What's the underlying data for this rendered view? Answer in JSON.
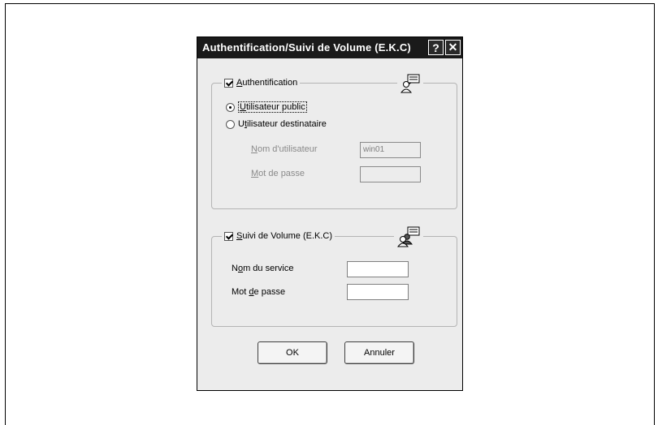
{
  "dialog": {
    "title": "Authentification/Suivi de Volume  (E.K.C)",
    "help_glyph": "?",
    "close_glyph": "✕"
  },
  "auth": {
    "legend_first": "A",
    "legend_rest": "uthentification",
    "checked": true,
    "icon": "user-card-icon",
    "public_first": "U",
    "public_rest": "tilisateur public",
    "dest_pre": "U",
    "dest_u": "t",
    "dest_rest": "ilisateur destinataire",
    "username_first": "N",
    "username_rest": "om d'utilisateur",
    "username_value": "win01",
    "password_first": "M",
    "password_rest": "ot de passe",
    "password_value": ""
  },
  "ekc": {
    "legend_first": "S",
    "legend_rest": "uivi de Volume  (E.K.C)",
    "checked": true,
    "icon": "users-card-icon",
    "service_pre": "N",
    "service_u": "o",
    "service_rest": "m du service",
    "service_value": "",
    "password_pre": "Mot ",
    "password_u": "d",
    "password_rest": "e passe",
    "password_value": ""
  },
  "buttons": {
    "ok": "OK",
    "cancel": "Annuler"
  }
}
